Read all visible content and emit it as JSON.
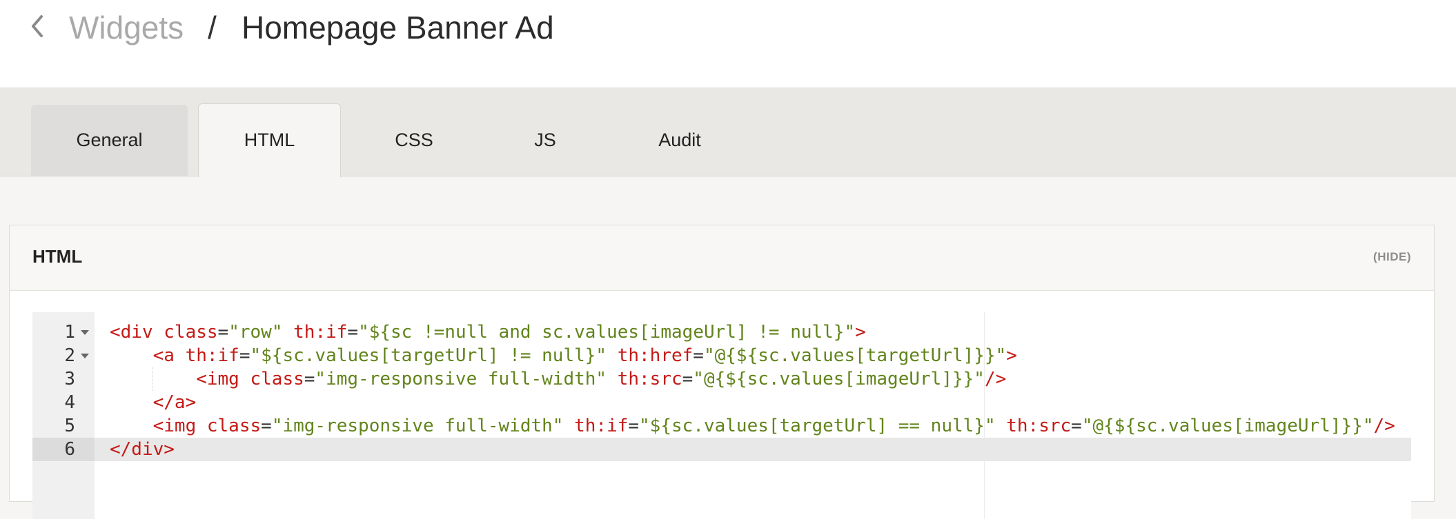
{
  "header": {
    "back_icon": "chevron-left-icon",
    "parent": "Widgets",
    "separator": "/",
    "current": "Homepage Banner Ad"
  },
  "tabs": [
    {
      "label": "General",
      "active": false
    },
    {
      "label": "HTML",
      "active": true
    },
    {
      "label": "CSS",
      "active": false
    },
    {
      "label": "JS",
      "active": false
    },
    {
      "label": "Audit",
      "active": false
    }
  ],
  "panel": {
    "title": "HTML",
    "hide_label": "(HIDE)"
  },
  "editor": {
    "current_line": 6,
    "lines": [
      {
        "number": "1",
        "foldable": true,
        "text": "<div class=\"row\" th:if=\"${sc !=null and sc.values[imageUrl] != null}\">"
      },
      {
        "number": "2",
        "foldable": true,
        "text": "    <a th:if=\"${sc.values[targetUrl] != null}\" th:href=\"@{${sc.values[targetUrl]}}\">"
      },
      {
        "number": "3",
        "foldable": false,
        "text": "        <img class=\"img-responsive full-width\" th:src=\"@{${sc.values[imageUrl]}}\"/>"
      },
      {
        "number": "4",
        "foldable": false,
        "text": "    </a>"
      },
      {
        "number": "5",
        "foldable": false,
        "text": "    <img class=\"img-responsive full-width\" th:if=\"${sc.values[targetUrl] == null}\" th:src=\"@{${sc.values[imageUrl]}}\"/>"
      },
      {
        "number": "6",
        "foldable": false,
        "text": "</div>"
      }
    ]
  },
  "colors": {
    "tag": "#c41a16",
    "string": "#62841b",
    "operator": "#333333"
  }
}
